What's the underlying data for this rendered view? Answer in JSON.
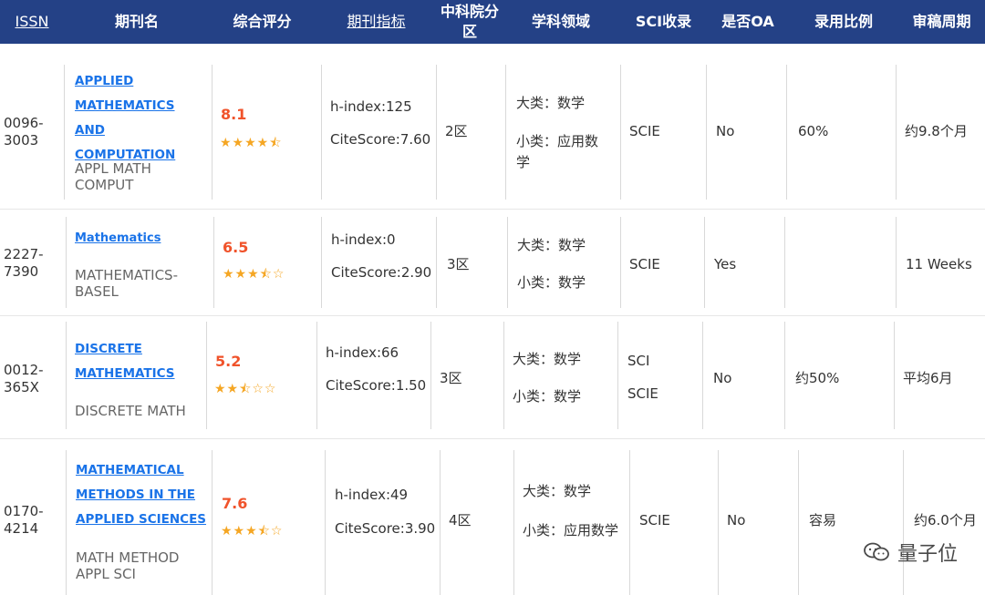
{
  "headers": {
    "issn": "ISSN",
    "name": "期刊名",
    "score": "综合评分",
    "metrics": "期刊指标",
    "cas": "中科院分区",
    "field": "学科领域",
    "sci": "SCI收录",
    "oa": "是否OA",
    "ratio": "录用比例",
    "review": "审稿周期"
  },
  "rows": [
    {
      "issn": "0096-3003",
      "name_full": "APPLIED MATHEMATICS AND COMPUTATION",
      "name_lines": [
        "APPLIED",
        "MATHEMATICS AND",
        "COMPUTATION"
      ],
      "abbr": "APPL MATH COMPUT",
      "score": "8.1",
      "rating": 4.5,
      "h_index": "h-index:125",
      "citescore": "CiteScore:7.60",
      "cas": "2区",
      "field_major": "大类：数学",
      "field_minor": "小类：应用数学",
      "sci": [
        "SCIE"
      ],
      "oa": "No",
      "ratio": "60%",
      "review": "约9.8个月"
    },
    {
      "issn": "2227-7390",
      "name_full": "Mathematics",
      "name_lines": [
        "Mathematics"
      ],
      "abbr": "MATHEMATICS-BASEL",
      "score": "6.5",
      "rating": 3.5,
      "h_index": "h-index:0",
      "citescore": "CiteScore:2.90",
      "cas": "3区",
      "field_major": "大类：数学",
      "field_minor": "小类：数学",
      "sci": [
        "SCIE"
      ],
      "oa": "Yes",
      "ratio": "",
      "review": "11 Weeks"
    },
    {
      "issn": "0012-365X",
      "name_full": "DISCRETE MATHEMATICS",
      "name_lines": [
        "DISCRETE",
        "MATHEMATICS"
      ],
      "abbr": "DISCRETE MATH",
      "score": "5.2",
      "rating": 2.5,
      "h_index": "h-index:66",
      "citescore": "CiteScore:1.50",
      "cas": "3区",
      "field_major": "大类：数学",
      "field_minor": "小类：数学",
      "sci": [
        "SCI",
        "SCIE"
      ],
      "oa": "No",
      "ratio": "约50%",
      "review": "平均6月"
    },
    {
      "issn": "0170-4214",
      "name_full": "MATHEMATICAL METHODS IN THE APPLIED SCIENCES",
      "name_lines": [
        "MATHEMATICAL",
        "METHODS IN THE",
        "APPLIED SCIENCES"
      ],
      "abbr": "MATH METHOD APPL SCI",
      "score": "7.6",
      "rating": 3.5,
      "h_index": "h-index:49",
      "citescore": "CiteScore:3.90",
      "cas": "4区",
      "field_major": "大类：数学",
      "field_minor": "小类：应用数学",
      "sci": [
        "SCIE"
      ],
      "oa": "No",
      "ratio": "容易",
      "review": "约6.0个月"
    }
  ],
  "watermark": {
    "text": "量子位",
    "icon": "wechat-icon"
  },
  "colors": {
    "header_bg": "#244186",
    "link": "#1a73e8",
    "score": "#f0532b",
    "star": "#f5a623"
  }
}
